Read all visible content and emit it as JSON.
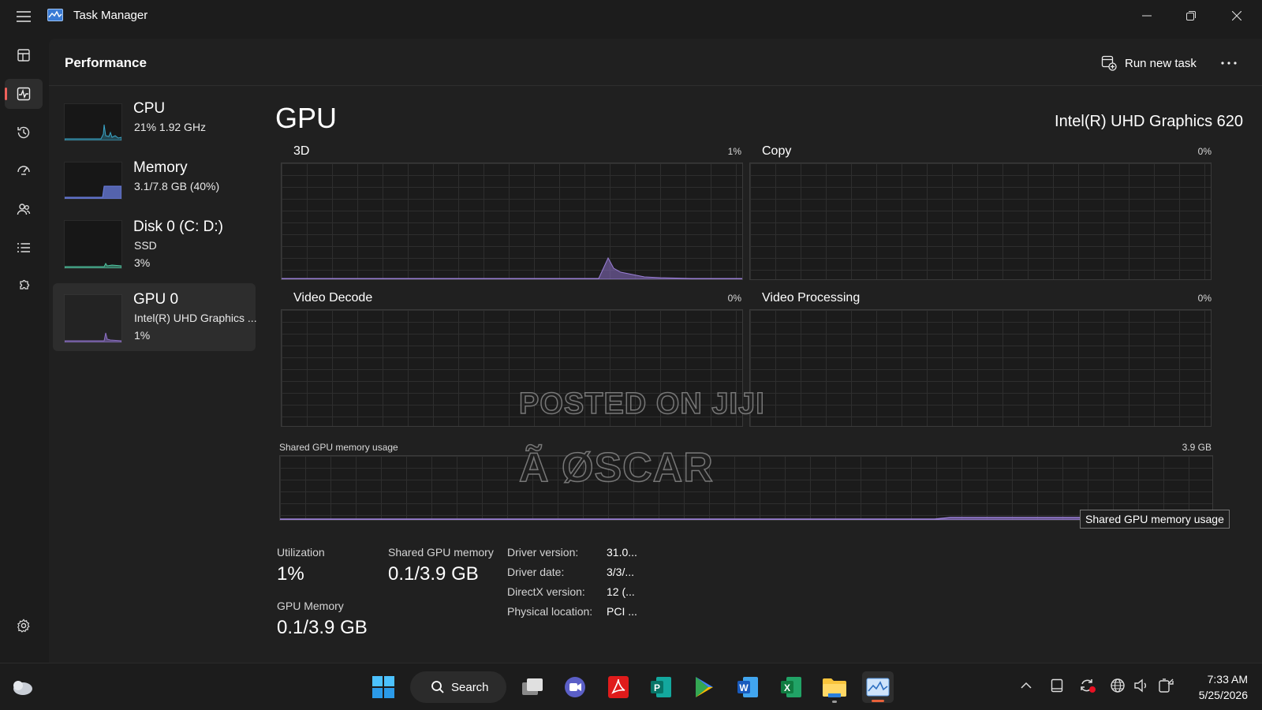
{
  "window": {
    "title": "Task Manager"
  },
  "header": {
    "title": "Performance",
    "run_task_label": "Run new task"
  },
  "devices": [
    {
      "name": "CPU",
      "line1": "21%  1.92 GHz",
      "line2": ""
    },
    {
      "name": "Memory",
      "line1": "3.1/7.8 GB (40%)",
      "line2": ""
    },
    {
      "name": "Disk 0 (C: D:)",
      "line1": "SSD",
      "line2": "3%"
    },
    {
      "name": "GPU 0",
      "line1": "Intel(R) UHD Graphics ...",
      "line2": "1%"
    }
  ],
  "gpu": {
    "title": "GPU",
    "model": "Intel(R) UHD Graphics 620",
    "graphs": [
      {
        "name": "3D",
        "percent": "1%"
      },
      {
        "name": "Copy",
        "percent": "0%"
      },
      {
        "name": "Video Decode",
        "percent": "0%"
      },
      {
        "name": "Video Processing",
        "percent": "0%"
      }
    ],
    "shared": {
      "caption": "Shared GPU memory usage",
      "max": "3.9 GB",
      "tooltip": "Shared GPU memory usage"
    },
    "stats": {
      "utilization_label": "Utilization",
      "utilization_value": "1%",
      "shared_label": "Shared GPU memory",
      "shared_value": "0.1/3.9 GB",
      "gpu_memory_label": "GPU Memory",
      "gpu_memory_value": "0.1/3.9 GB"
    },
    "info": [
      {
        "label": "Driver version:",
        "value": "31.0..."
      },
      {
        "label": "Driver date:",
        "value": "3/3/..."
      },
      {
        "label": "DirectX version:",
        "value": "12 (..."
      },
      {
        "label": "Physical location:",
        "value": "PCI ..."
      }
    ]
  },
  "watermark": {
    "line1": "POSTED ON JIJI",
    "line2": "Ã ØSCAR"
  },
  "taskbar": {
    "search_label": "Search",
    "time": "7:33 AM",
    "date": "5/25/2026"
  },
  "colors": {
    "accent": "#f0615b",
    "gpu_graph": "#8b6fc4",
    "cpu_graph": "#3aa7c9",
    "memory_graph": "#6a7ee0",
    "disk_graph": "#4fc4a0"
  }
}
